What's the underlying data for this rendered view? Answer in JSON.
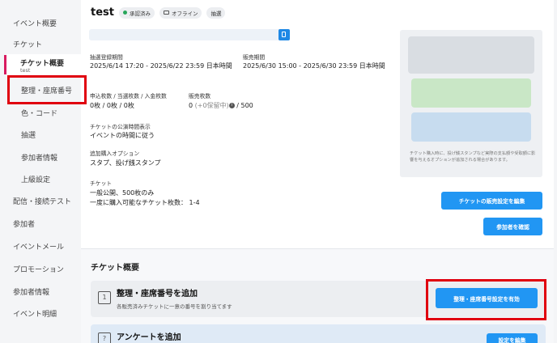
{
  "sidebar": {
    "items": [
      {
        "label": "イベント概要"
      },
      {
        "label": "チケット"
      },
      {
        "label": "整理・座席番号"
      },
      {
        "label": "色・コード"
      },
      {
        "label": "抽選"
      },
      {
        "label": "参加者情報"
      },
      {
        "label": "上級設定"
      },
      {
        "label": "配信・接続テスト"
      },
      {
        "label": "参加者"
      },
      {
        "label": "イベントメール"
      },
      {
        "label": "プロモーション"
      },
      {
        "label": "参加者情報"
      },
      {
        "label": "イベント明細"
      }
    ],
    "active": {
      "label": "チケット概要",
      "sublabel": "test"
    }
  },
  "header": {
    "title": "test",
    "badges": {
      "approved": "承認済み",
      "offline": "オフライン",
      "lottery": "抽選"
    }
  },
  "details": {
    "lottery_period_label": "抽選登録期間",
    "lottery_period_value": "2025/6/14 17:20 - 2025/6/22 23:59 日本時間",
    "sales_period_label": "販売期間",
    "sales_period_value": "2025/6/30 15:00 - 2025/6/30 23:59 日本時間",
    "counts_label": "申込枚数 / 当選枚数 / 入金枚数",
    "counts_value": "0枚 / 0枚 / 0枚",
    "sold_label": "販売枚数",
    "sold_value": "0",
    "sold_reserved": "(+0保留中)",
    "sold_total": "/ 500",
    "display_time_label": "チケットの公演時間表示",
    "display_time_value": "イベントの時間に従う",
    "options_label": "追加購入オプション",
    "options_value": "スタプ、投げ銭スタンプ",
    "ticket_label": "チケット",
    "ticket_line1": "一般公開、500枚のみ",
    "ticket_line2": "一度に購入可能なチケット枚数： 1-4"
  },
  "preview": {
    "note": "チケット購入時に、投げ銭スタンプなど実際の支払額や受取額に影響を与えるオプションが追加される場合があります。"
  },
  "buttons": {
    "edit_sales": "チケットの販売設定を編集",
    "view_attendees": "参加者を確認",
    "enable_numbering": "整理・座席番号設定を有効",
    "edit_survey": "設定を編集"
  },
  "section": {
    "title": "チケット概要",
    "numbering_title": "整理・座席番号を追加",
    "numbering_desc": "各販売済みチケットに一意の番号を割り当てます",
    "survey_title": "アンケートを追加"
  },
  "colors": {
    "accent": "#2196f3",
    "highlight": "#e0000f",
    "active_bar": "#d81b60"
  }
}
